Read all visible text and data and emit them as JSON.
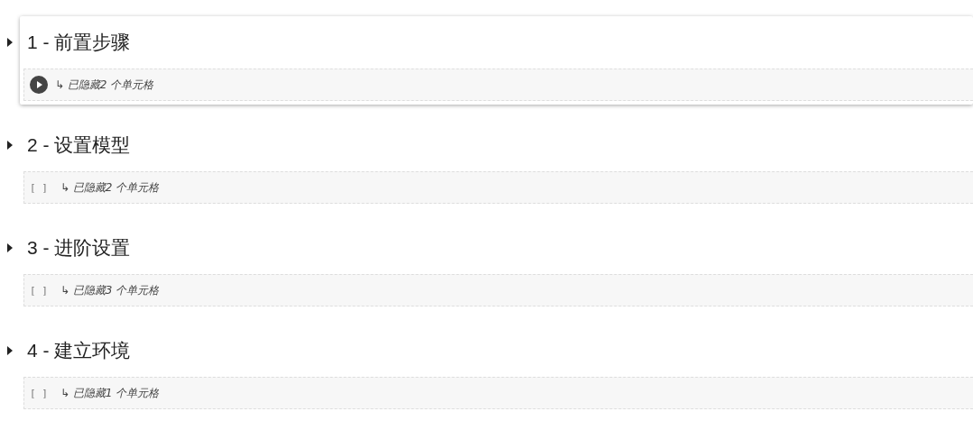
{
  "sections": [
    {
      "title": "1 - 前置步骤",
      "selected": true,
      "expanded": false,
      "hidden_cells": "↳ 已隐藏2 个单元格"
    },
    {
      "title": "2 - 设置模型",
      "selected": false,
      "expanded": false,
      "run_indicator": "[ ]",
      "hidden_cells": "↳ 已隐藏2 个单元格"
    },
    {
      "title": "3 - 进阶设置",
      "selected": false,
      "expanded": false,
      "run_indicator": "[ ]",
      "hidden_cells": "↳ 已隐藏3 个单元格"
    },
    {
      "title": "4 - 建立环境",
      "selected": false,
      "expanded": false,
      "run_indicator": "[ ]",
      "hidden_cells": "↳ 已隐藏1 个单元格"
    }
  ]
}
